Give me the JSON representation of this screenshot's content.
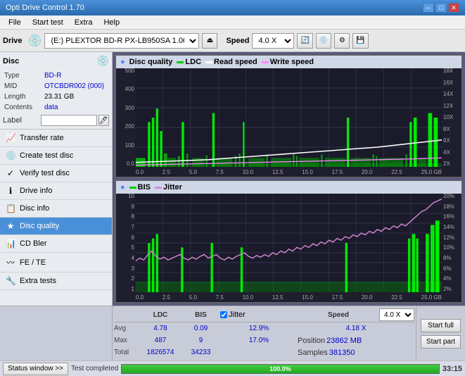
{
  "titleBar": {
    "title": "Opti Drive Control 1.70",
    "minimize": "─",
    "maximize": "□",
    "close": "✕"
  },
  "menuBar": {
    "items": [
      "File",
      "Start test",
      "Extra",
      "Help"
    ]
  },
  "driveToolbar": {
    "driveLabel": "Drive",
    "driveValue": "(E:) PLEXTOR BD-R  PX-LB950SA 1.06",
    "speedLabel": "Speed",
    "speedValue": "4.0 X"
  },
  "disc": {
    "title": "Disc",
    "typeLabel": "Type",
    "typeValue": "BD-R",
    "midLabel": "MID",
    "midValue": "OTCBDR002 (000)",
    "lengthLabel": "Length",
    "lengthValue": "23.31 GB",
    "contentsLabel": "Contents",
    "contentsValue": "data",
    "labelLabel": "Label",
    "labelValue": ""
  },
  "navItems": [
    {
      "id": "transfer-rate",
      "label": "Transfer rate",
      "icon": "📈"
    },
    {
      "id": "create-test-disc",
      "label": "Create test disc",
      "icon": "💿"
    },
    {
      "id": "verify-test-disc",
      "label": "Verify test disc",
      "icon": "✓"
    },
    {
      "id": "drive-info",
      "label": "Drive info",
      "icon": "ℹ"
    },
    {
      "id": "disc-info",
      "label": "Disc info",
      "icon": "📋"
    },
    {
      "id": "disc-quality",
      "label": "Disc quality",
      "icon": "★",
      "active": true
    },
    {
      "id": "cd-bler",
      "label": "CD Bler",
      "icon": "📊"
    },
    {
      "id": "fe-te",
      "label": "FE / TE",
      "icon": "〰"
    },
    {
      "id": "extra-tests",
      "label": "Extra tests",
      "icon": "🔧"
    }
  ],
  "chartTop": {
    "title": "Disc quality",
    "legend": [
      {
        "label": "LDC",
        "color": "#00cc00"
      },
      {
        "label": "Read speed",
        "color": "#ffffff"
      },
      {
        "label": "Write speed",
        "color": "#ff88ff"
      }
    ],
    "yAxisLeft": [
      "500",
      "400",
      "300",
      "200",
      "100",
      "0.0"
    ],
    "yAxisRight": [
      "18X",
      "16X",
      "14X",
      "12X",
      "10X",
      "8X",
      "6X",
      "4X",
      "2X"
    ],
    "xAxis": [
      "0.0",
      "2.5",
      "5.0",
      "7.5",
      "10.0",
      "12.5",
      "15.0",
      "17.5",
      "20.0",
      "22.5",
      "25.0 GB"
    ]
  },
  "chartBottom": {
    "legend": [
      {
        "label": "BIS",
        "color": "#00cc00"
      },
      {
        "label": "Jitter",
        "color": "#dd88dd"
      }
    ],
    "yAxisLeft": [
      "10",
      "9",
      "8",
      "7",
      "6",
      "5",
      "4",
      "3",
      "2",
      "1"
    ],
    "yAxisRight": [
      "20%",
      "18%",
      "16%",
      "14%",
      "12%",
      "10%",
      "8%",
      "6%",
      "4%",
      "2%"
    ],
    "xAxis": [
      "0.0",
      "2.5",
      "5.0",
      "7.5",
      "10.0",
      "12.5",
      "15.0",
      "17.5",
      "20.0",
      "22.5",
      "25.0 GB"
    ]
  },
  "stats": {
    "headers": [
      "LDC",
      "BIS",
      "",
      "Jitter",
      "Speed",
      ""
    ],
    "avg": {
      "ldc": "4.78",
      "bis": "0.09",
      "jitter": "12.9%"
    },
    "max": {
      "ldc": "487",
      "bis": "9",
      "jitter": "17.0%"
    },
    "total": {
      "ldc": "1826574",
      "bis": "34233"
    },
    "speedVal": "4.18 X",
    "speedSelect": "4.0 X",
    "position": "23862 MB",
    "samples": "381350",
    "startFull": "Start full",
    "startPart": "Start part"
  },
  "statusBar": {
    "statusWindowBtn": "Status window >>",
    "statusText": "Test completed",
    "progressPct": 100,
    "time": "33:15"
  }
}
